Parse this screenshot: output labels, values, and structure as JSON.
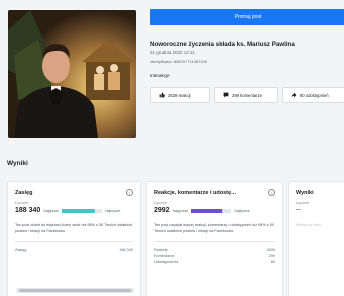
{
  "post": {
    "promote_label": "Promuj post",
    "title": "Noworoczne życzenia składa ks. Mariusz Pawlina",
    "date": "31 grudnia 2022 12:11",
    "id_line": "Identyfikator: 888767711467300",
    "interactions_label": "Interakcje",
    "reactions": "2639 reakcji",
    "comments": "299 komentarze",
    "shares": "80 udostępnień"
  },
  "results": {
    "title": "Wyniki",
    "reach": {
      "title": "Zasięg",
      "sub": "Łącznie",
      "value": "188 340",
      "tag_left": "Najgorsze",
      "tag_right": "Najlepsze",
      "bar_fraction": 0.82,
      "description": "Ten post dotarł do większej liczby osób niż 98% z 50 Twoich ostatnich postów i relacji na Facebooku.",
      "rows": [
        {
          "label": "Zasięg",
          "value": "188 340"
        }
      ]
    },
    "engagement": {
      "title": "Reakcje, komentarze i udostę…",
      "sub": "Łącznie",
      "value": "2992",
      "tag_left": "Najgorsze",
      "tag_right": "Najlepsze",
      "bar_fraction": 0.78,
      "description": "Ten post uzyskał więcej reakcji, komentarzy i udostępnień niż 98% z 50 Twoich ostatnich postów i relacji na Facebooku.",
      "rows": [
        {
          "label": "Reakcje",
          "value": "2639"
        },
        {
          "label": "Komentarze",
          "value": "299"
        },
        {
          "label": "Udostępnienia",
          "value": "80"
        }
      ]
    },
    "third": {
      "title": "Wyniki",
      "sub": "Łącznie",
      "value": "—",
      "faint": "Kliknięcia linku"
    }
  },
  "colors": {
    "primary": "#1877f2",
    "reach_bar": "#3fc9c4",
    "engagement_bar": "#6a4ed8"
  }
}
